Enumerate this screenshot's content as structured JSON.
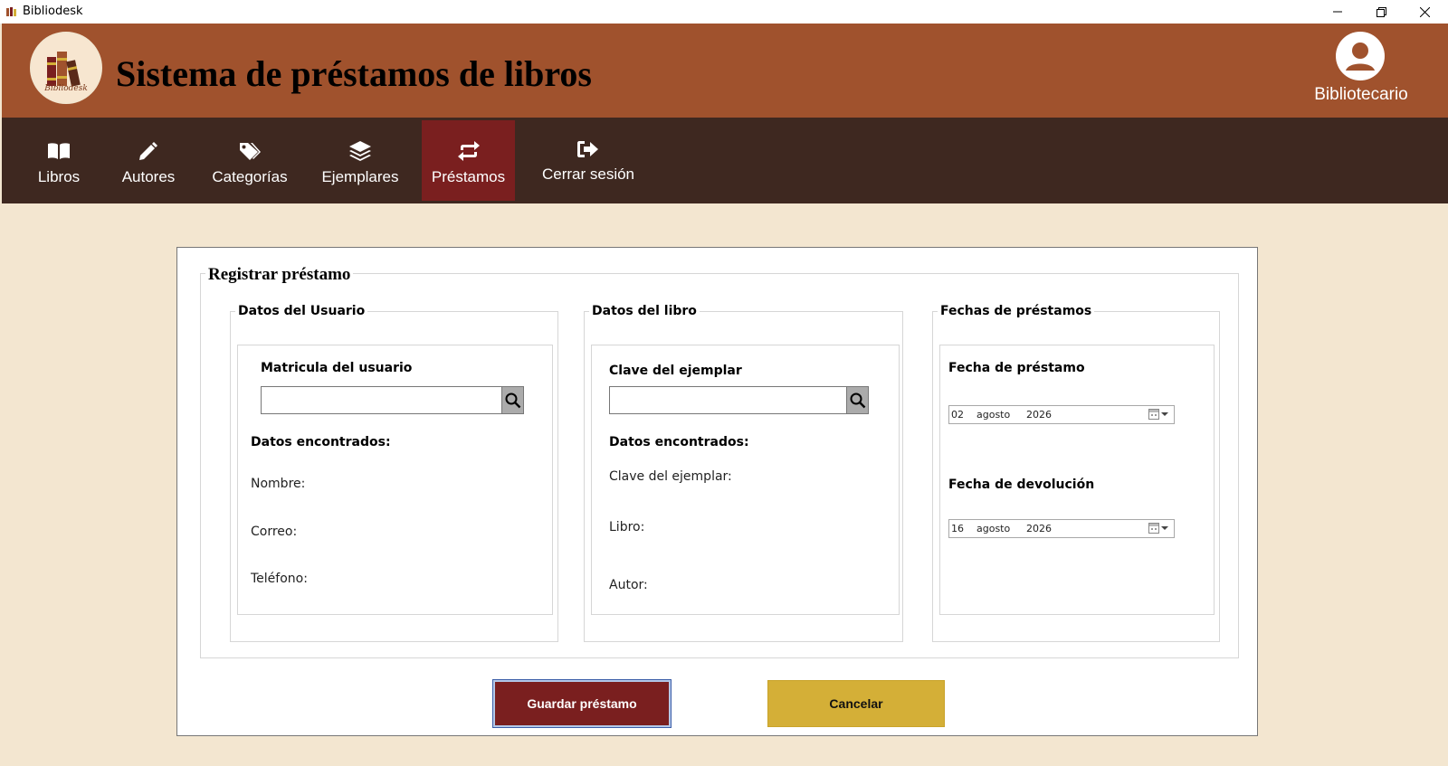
{
  "window": {
    "title": "Bibliodesk"
  },
  "header": {
    "title": "Sistema de préstamos de libros",
    "logo_text": "Bibliodesk",
    "user_label": "Bibliotecario"
  },
  "nav": {
    "items": [
      {
        "label": "Libros",
        "icon": "book-open-icon"
      },
      {
        "label": "Autores",
        "icon": "pencil-icon"
      },
      {
        "label": "Categorías",
        "icon": "tags-icon"
      },
      {
        "label": "Ejemplares",
        "icon": "layers-icon"
      },
      {
        "label": "Préstamos",
        "icon": "exchange-icon",
        "active": true
      },
      {
        "label": "Cerrar sesión",
        "icon": "sign-out-icon"
      }
    ]
  },
  "form": {
    "title": "Registrar préstamo",
    "usuario": {
      "legend": "Datos del Usuario",
      "field_label": "Matricula del usuario",
      "field_value": "",
      "found_label": "Datos encontrados:",
      "nombre": "Nombre:",
      "correo": "Correo:",
      "telefono": "Teléfono:"
    },
    "libro": {
      "legend": "Datos del libro",
      "field_label": "Clave del ejemplar",
      "field_value": "",
      "found_label": "Datos encontrados:",
      "clave": "Clave del ejemplar:",
      "libro": "Libro:",
      "autor": "Autor:"
    },
    "fechas": {
      "legend": "Fechas de préstamos",
      "prestamo_label": "Fecha de préstamo",
      "prestamo": {
        "day": "02",
        "month": "agosto",
        "year": "2026"
      },
      "devolucion_label": "Fecha de devolución",
      "devolucion": {
        "day": "16",
        "month": "agosto",
        "year": "2026"
      }
    },
    "save_label": "Guardar préstamo",
    "cancel_label": "Cancelar"
  },
  "colors": {
    "header": "#a0522d",
    "nav": "#3e2820",
    "active_tab": "#7a1f1f",
    "background": "#f3e6d0",
    "cancel": "#d4af37"
  }
}
